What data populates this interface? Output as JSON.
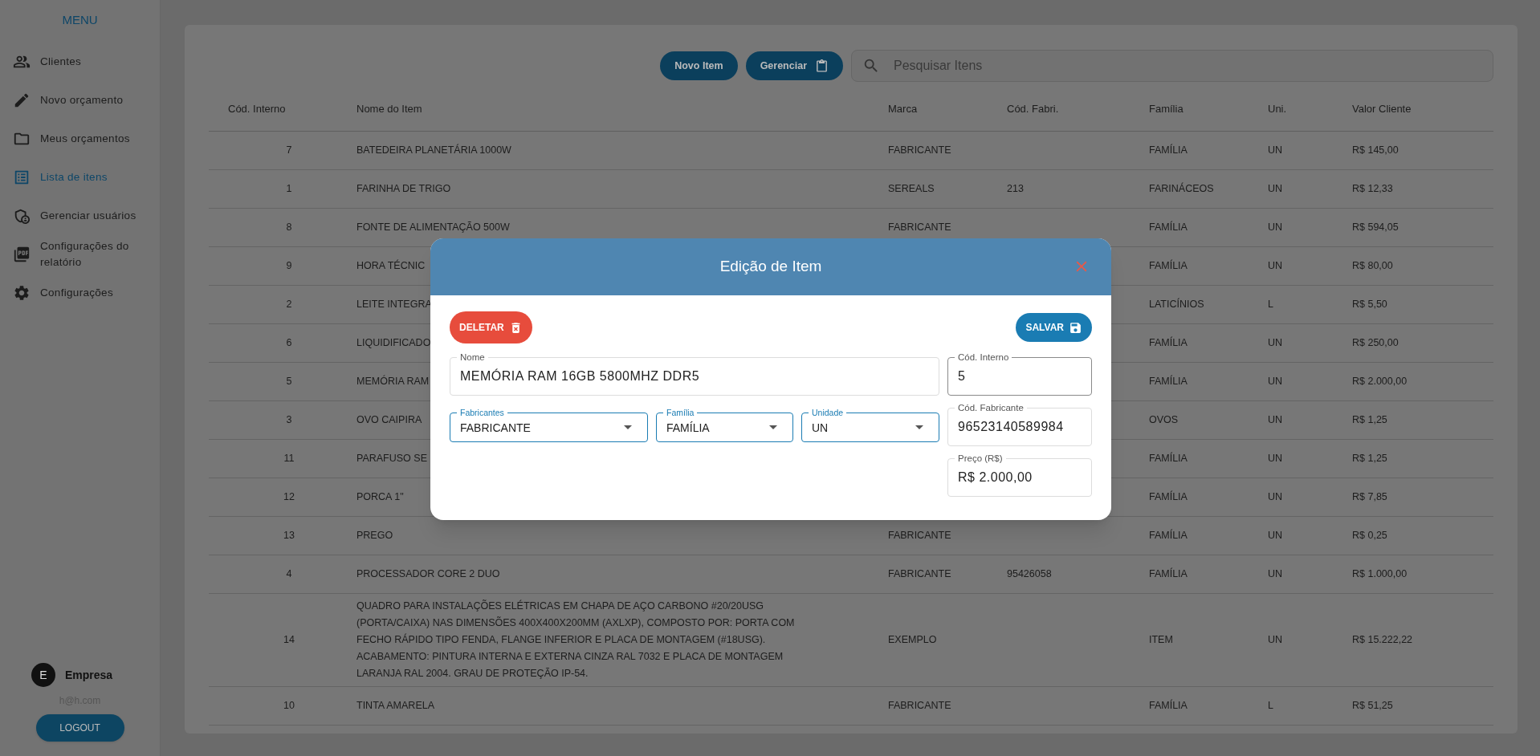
{
  "sidebar": {
    "title": "MENU",
    "items": [
      {
        "label": "Clientes",
        "selected": false
      },
      {
        "label": "Novo orçamento",
        "selected": false
      },
      {
        "label": "Meus orçamentos",
        "selected": false
      },
      {
        "label": "Lista de itens",
        "selected": true
      },
      {
        "label": "Gerenciar usuários",
        "selected": false
      },
      {
        "label": "Configurações do relatório",
        "selected": false
      },
      {
        "label": "Configurações",
        "selected": false
      }
    ],
    "user": {
      "initial": "E",
      "name": "Empresa",
      "email": "h@h.com"
    },
    "logout": "LOGOUT"
  },
  "toolbar": {
    "buttons": [
      {
        "label": "Novo Item"
      },
      {
        "label": "Gerenciar"
      }
    ],
    "search": {
      "placeholder": "Pesquisar Itens"
    }
  },
  "table": {
    "columns": [
      "Cód. Interno",
      "Nome do Item",
      "Marca",
      "Cód. Fabri.",
      "Família",
      "Uni.",
      "Valor Cliente"
    ],
    "rows": [
      {
        "code": "7",
        "name": "BATEDEIRA PLANETÁRIA 1000W",
        "brand": "FABRICANTE",
        "family": "FAMÍLIA",
        "unit": "UN",
        "price": "R$ 145,00"
      },
      {
        "code": "1",
        "name": "FARINHA DE TRIGO",
        "brand": "SEREALS",
        "mfr_code": "213",
        "family": "FARINÁCEOS",
        "unit": "UN",
        "price": "R$ 12,33"
      },
      {
        "code": "8",
        "name": "FONTE DE ALIMENTAÇÃO 500W",
        "brand": "FABRICANTE",
        "family": "FAMÍLIA",
        "unit": "UN",
        "price": "R$ 594,05"
      },
      {
        "code": "9",
        "name": "HORA TÉCNIC",
        "family": "FAMÍLIA",
        "unit": "UN",
        "price": "R$ 80,00"
      },
      {
        "code": "2",
        "name": "LEITE INTEGRA",
        "family": "LATICÍNIOS",
        "unit": "L",
        "price": "R$ 5,50"
      },
      {
        "code": "6",
        "name": "LIQUIDIFICADO",
        "family": "FAMÍLIA",
        "unit": "UN",
        "price": "R$ 250,00"
      },
      {
        "code": "5",
        "name": "MEMÓRIA RAM",
        "family": "FAMÍLIA",
        "unit": "UN",
        "price": "R$ 2.000,00"
      },
      {
        "code": "3",
        "name": "OVO CAIPIRA",
        "family": "OVOS",
        "unit": "UN",
        "price": "R$ 1,25"
      },
      {
        "code": "11",
        "name": "PARAFUSO SE",
        "family": "FAMÍLIA",
        "unit": "UN",
        "price": "R$ 1,25"
      },
      {
        "code": "12",
        "name": "PORCA 1\"",
        "family": "FAMÍLIA",
        "unit": "UN",
        "price": "R$ 7,85"
      },
      {
        "code": "13",
        "name": "PREGO",
        "brand": "FABRICANTE",
        "family": "FAMÍLIA",
        "unit": "UN",
        "price": "R$ 0,25"
      },
      {
        "code": "4",
        "name": "PROCESSADOR CORE 2 DUO",
        "brand": "FABRICANTE",
        "mfr_code": "95426058",
        "family": "FAMÍLIA",
        "unit": "UN",
        "price": "R$ 1.000,00"
      },
      {
        "code": "14",
        "name": "QUADRO PARA INSTALAÇÕES ELÉTRICAS EM CHAPA DE AÇO CARBONO #20/20USG (PORTA/CAIXA) NAS DIMENSÕES 400X400X200MM (AXLXP), COMPOSTO POR: PORTA COM FECHO RÁPIDO TIPO FENDA, FLANGE INFERIOR E PLACA DE MONTAGEM (#18USG). ACABAMENTO: PINTURA INTERNA E EXTERNA CINZA RAL 7032 E PLACA DE MONTAGEM LARANJA RAL 2004. GRAU DE PROTEÇÃO IP-54.",
        "brand": "EXEMPLO",
        "family": "ITEM",
        "unit": "UN",
        "price": "R$ 15.222,22"
      },
      {
        "code": "10",
        "name": "TINTA AMARELA",
        "brand": "FABRICANTE",
        "family": "FAMÍLIA",
        "unit": "L",
        "price": "R$ 51,25"
      }
    ]
  },
  "modal": {
    "title": "Edição de Item",
    "delete_button": "DELETAR",
    "save_button": "SALVAR",
    "fields": [
      {
        "kind": "text",
        "label": "Nome",
        "value": "MEMÓRIA RAM 16GB 5800MHZ DDR5",
        "hovered": false
      },
      {
        "kind": "text",
        "label": "Cód. Interno",
        "value": "5",
        "hovered": true
      },
      {
        "kind": "select",
        "label": "Fabricantes",
        "value": "FABRICANTE"
      },
      {
        "kind": "select",
        "label": "Família",
        "value": "FAMÍLIA"
      },
      {
        "kind": "select",
        "label": "Unidade",
        "value": "UN"
      },
      {
        "kind": "text",
        "label": "Cód. Fabricante",
        "value": "96523140589984",
        "hovered": false
      },
      {
        "kind": "text",
        "label": "Preço (R$)",
        "value": "R$ 2.000,00",
        "hovered": false
      }
    ]
  }
}
